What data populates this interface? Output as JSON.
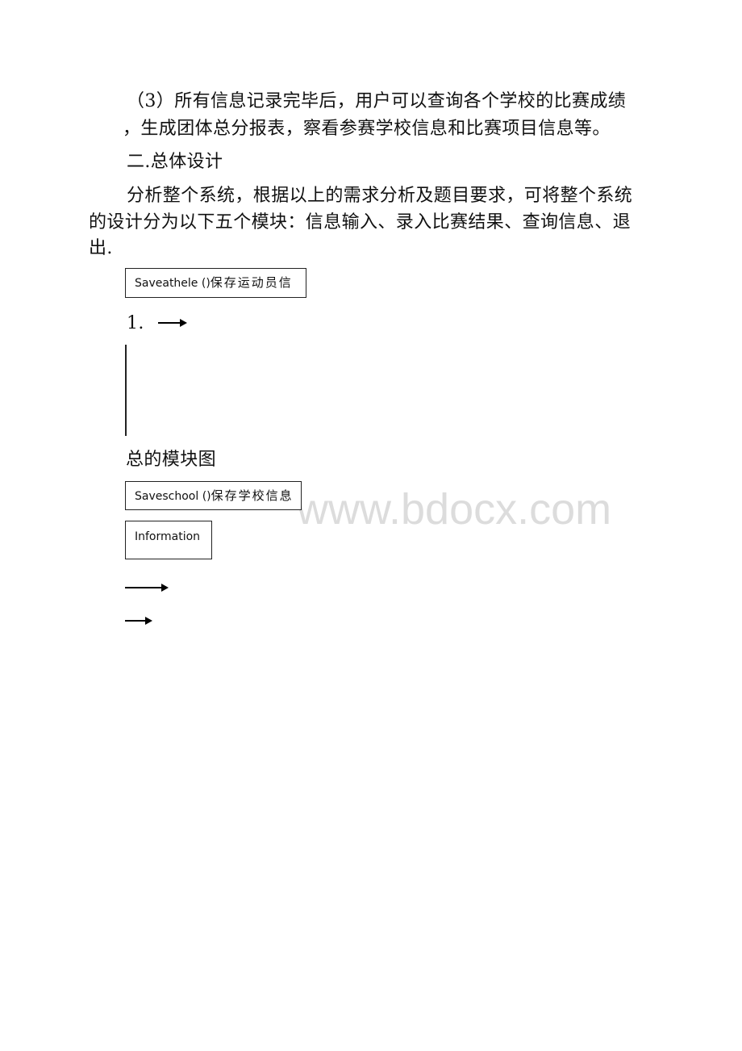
{
  "document": {
    "paragraph_requirement_3": {
      "line1": "（3）所有信息记录完毕后，用户可以查询各个学校的比赛成绩",
      "line2": "，生成团体总分报表，察看参赛学校信息和比赛项目信息等。"
    },
    "section_heading": "二.总体设计",
    "paragraph_analysis": {
      "line1": "分析整个系统，根据以上的需求分析及题目要求，可将整个系统",
      "line2": "的设计分为以下五个模块：信息输入、录入比赛结果、查询信息、退",
      "line3": "出."
    },
    "diagram": {
      "box_saveathele": {
        "code": "Saveathele  ()",
        "label": "保存运动员信"
      },
      "list_number": "1.",
      "caption": "总的模块图",
      "box_saveschool": {
        "code": "Saveschool ()",
        "label": "保存学校信息"
      },
      "box_information": {
        "label": "Information"
      }
    }
  },
  "watermark": "www.bdocx.com"
}
